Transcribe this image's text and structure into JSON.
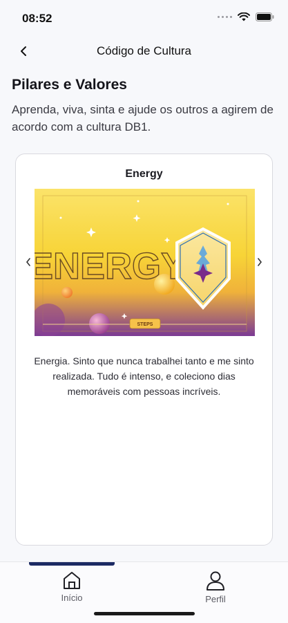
{
  "status_bar": {
    "time": "08:52"
  },
  "header": {
    "title": "Código de Cultura",
    "back_icon": "chevron-left-icon"
  },
  "section": {
    "title": "Pilares e Valores",
    "description": "Aprenda, viva, sinta e ajude os outros a agirem de acordo com a cultura DB1."
  },
  "card": {
    "title": "Energy",
    "banner": {
      "headline": "ENERGY",
      "footer_label": "STEPS"
    },
    "text": "Energia. Sinto que nunca trabalhei tanto e me sinto realizada. Tudo é intenso, e coleciono dias memoráveis com pessoas incríveis.",
    "prev_icon": "chevron-left-icon",
    "next_icon": "chevron-right-icon"
  },
  "bottom_nav": {
    "items": [
      {
        "label": "Início",
        "icon": "home-icon",
        "active": true
      },
      {
        "label": "Perfil",
        "icon": "person-icon",
        "active": false
      }
    ]
  },
  "colors": {
    "accent": "#1c2a63",
    "banner_yellow": "#f7d63a",
    "banner_purple": "#7a3a9a"
  }
}
